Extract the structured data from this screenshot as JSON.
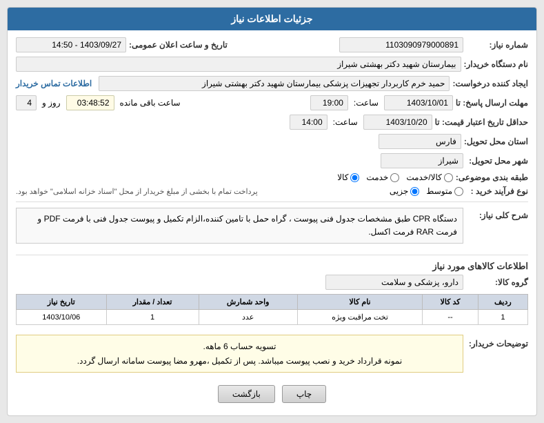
{
  "header": {
    "title": "جزئیات اطلاعات نیاز"
  },
  "fields": {
    "shomareNiaz_label": "شماره نیاز:",
    "shomareNiaz_value": "1103090979000891",
    "namDastgah_label": "نام دستگاه خریدار:",
    "namDastgah_value": "بیمارستان شهید دکتر بهشتی شیراز",
    "tarikh_label": "تاریخ و ساعت اعلان عمومی:",
    "tarikh_value": "1403/09/27 - 14:50",
    "ijadKonande_label": "ایجاد کننده درخواست:",
    "ijadKonande_value": "حمید خرم کاربردار تجهیزات پزشکی بیمارستان شهید دکتر بهشتی شیراز",
    "temasLink": "اطلاعات تماس خریدار",
    "mohlat_label": "مهلت ارسال پاسخ: تا",
    "mohlat_date": "1403/10/01",
    "mohlat_time_label": "ساعت:",
    "mohlat_time": "19:00",
    "mohlat_day_label": "روز و",
    "mohlat_day": "4",
    "mohlat_remain_label": "ساعت باقی مانده",
    "mohlat_remain": "03:48:52",
    "hadaqal_label": "حداقل تاریخ اعتبار قیمت: تا",
    "hadaqal_date": "1403/10/20",
    "hadaqal_time_label": "ساعت:",
    "hadaqal_time": "14:00",
    "ostan_label": "استان محل تحویل:",
    "ostan_value": "فارس",
    "shahr_label": "شهر محل تحویل:",
    "shahr_value": "شیراز",
    "tabaghe_label": "طبقه بندی موضوعی:",
    "tabaghe_options": [
      "کالا",
      "خدمت",
      "کالا/خدمت"
    ],
    "tabaghe_selected": "کالا",
    "noFarayand_label": "نوع فرآیند خرید :",
    "noFarayand_options": [
      "جزیی",
      "متوسط"
    ],
    "noFarayand_extra": "پرداخت تمام با بخشی از مبلغ خریدار از محل \"اسناد خزانه اسلامی\" خواهد بود.",
    "sharh_label": "شرح کلی نیاز:",
    "sharh_value": "دستگاه CPR طبق مشخصات جدول فنی پیوست ، گراه حمل با تامین کننده،الزام تکمیل و پیوست جدول فنی با فرمت PDF و فرمت RAR فرمت اکسل."
  },
  "kalaSection": {
    "title": "اطلاعات کالاهای مورد نیاز",
    "groupLabel": "گروه کالا:",
    "groupValue": "دارو، پزشکی و سلامت",
    "tableHeaders": [
      "ردیف",
      "کد کالا",
      "نام کالا",
      "واحد شمارش",
      "تعداد / مقدار",
      "تاریخ نیاز"
    ],
    "tableRows": [
      {
        "radif": "1",
        "kodKala": "--",
        "namKala": "تخت مراقبت ویژه",
        "vahed": "عدد",
        "tedad": "1",
        "tarikh": "1403/10/06"
      }
    ]
  },
  "notes": {
    "label": "توضیحات خریدار:",
    "line1": "تسویه حساب 6 ماهه.",
    "line2": "نمونه قرارداد خرید و نصب پیوست میباشد. پس از تکمیل ،مهرو مضا پیوست سامانه ارسال گردد."
  },
  "buttons": {
    "back": "بازگشت",
    "print": "چاپ"
  }
}
